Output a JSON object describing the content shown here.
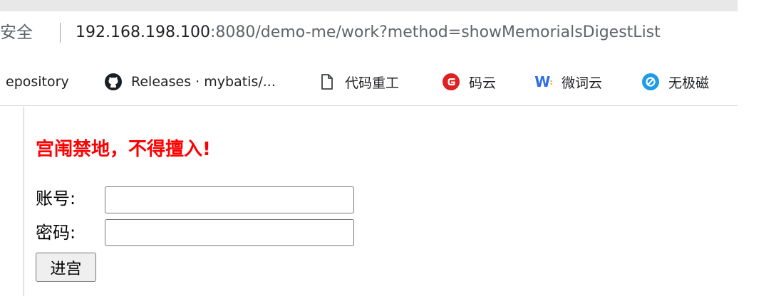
{
  "browser": {
    "security_label": "安全",
    "url_host": "192.168.198.100",
    "url_rest": ":8080/demo-me/work?method=showMemorialsDigestList"
  },
  "bookmarks": [
    {
      "label": "epository",
      "icon": "none"
    },
    {
      "label": "Releases · mybatis/...",
      "icon": "github-icon"
    },
    {
      "label": "代码重工",
      "icon": "page-icon"
    },
    {
      "label": "码云",
      "icon": "gitee-icon"
    },
    {
      "label": "微词云",
      "icon": "weiciyun-icon"
    },
    {
      "label": "无极磁",
      "icon": "wuji-icon"
    }
  ],
  "page": {
    "warning": "宫闱禁地，不得擅入!",
    "account_label": "账号:",
    "account_value": "",
    "password_label": "密码:",
    "password_value": "",
    "submit_label": "进宫"
  },
  "colors": {
    "warning": "#ff0000",
    "gitee": "#e02020",
    "weiciyun": "#2f6fe8",
    "wuji": "#1e9be9"
  }
}
